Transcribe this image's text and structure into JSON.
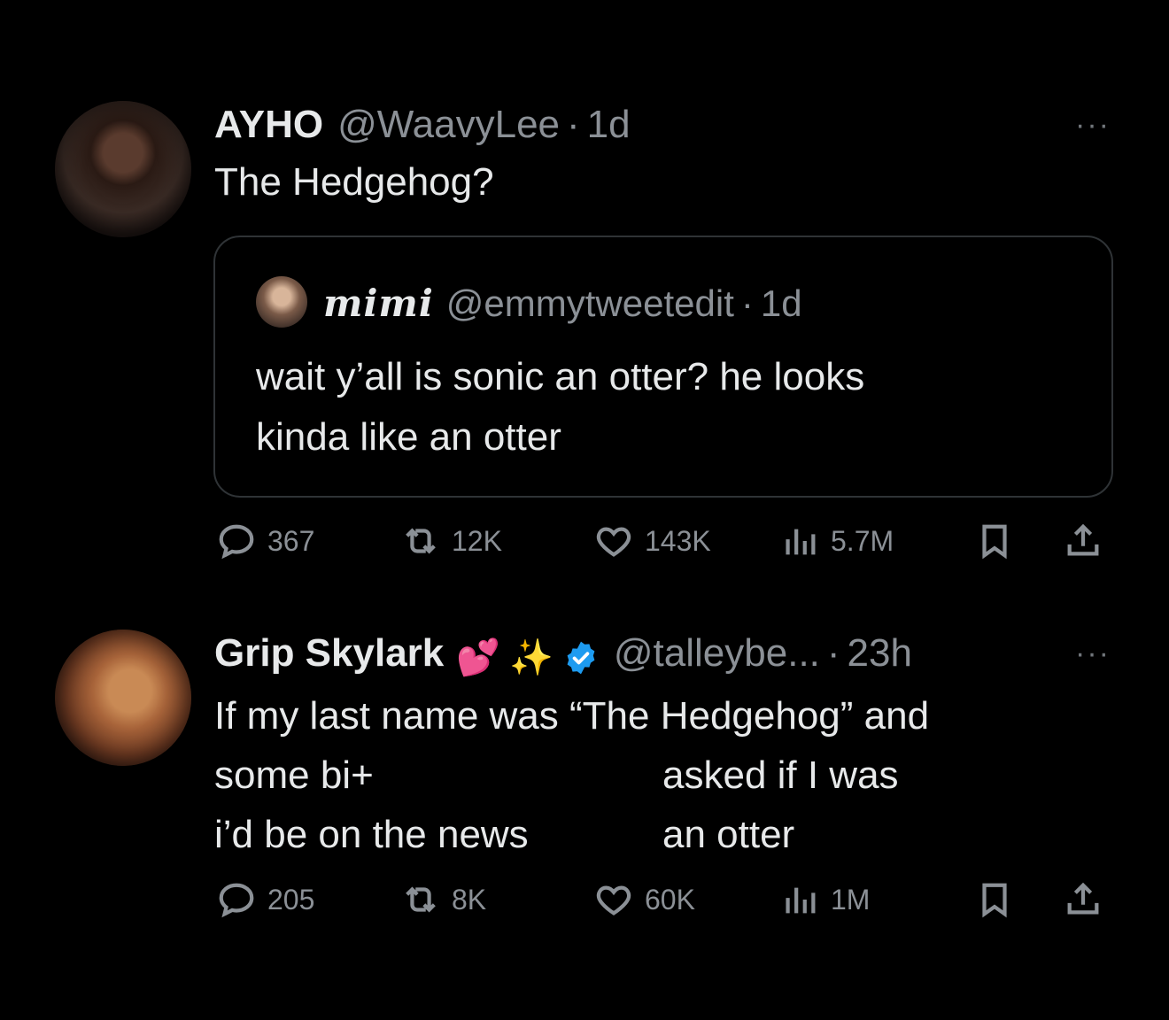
{
  "tweets": [
    {
      "author": "AYHO",
      "handle": "@WaavyLee",
      "dot": "·",
      "time": "1d",
      "more": "···",
      "text": [
        "The Hedgehog?"
      ],
      "quote": {
        "author": "mimi",
        "handle": "@emmytweetedit",
        "dot": "·",
        "time": "1d",
        "text": [
          "wait y’all is sonic an otter? he looks",
          "kinda like an otter"
        ]
      },
      "stats": {
        "replies": "367",
        "retweets": "12K",
        "likes": "143K",
        "views": "5.7M"
      }
    },
    {
      "author": "Grip Skylark",
      "badges": {
        "heart": "💕",
        "sparkle": "✨"
      },
      "handle": "@talleybe...",
      "dot": "·",
      "time": "23h",
      "more": "···",
      "text": [
        "If my last name was “The Hedgehog” and",
        "some bi+",
        "asked if I was an otter",
        "i’d be on the news"
      ],
      "stats": {
        "replies": "205",
        "retweets": "8K",
        "likes": "60K",
        "views": "1M"
      }
    }
  ],
  "colors": {
    "background": "#000000",
    "text": "#e7e9ea",
    "muted": "#8b9096",
    "border": "#2f3336",
    "verified": "#1d9bf0"
  },
  "icons": [
    "reply-icon",
    "retweet-icon",
    "like-icon",
    "views-icon",
    "bookmark-icon",
    "share-icon",
    "verified-icon",
    "more-icon"
  ]
}
